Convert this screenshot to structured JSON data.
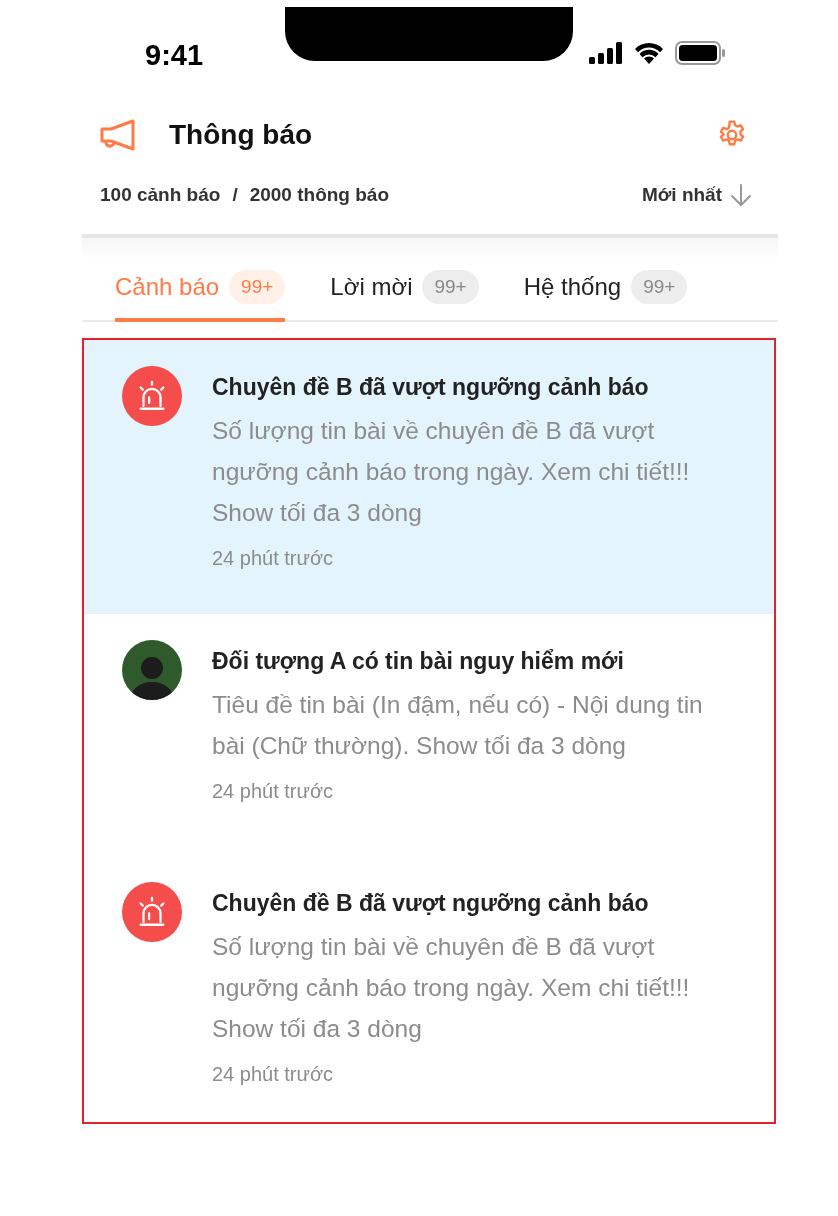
{
  "status_bar": {
    "time": "9:41"
  },
  "header": {
    "title": "Thông báo",
    "alert_count": "100 cảnh báo",
    "separator": "/",
    "notification_count": "2000 thông báo",
    "sort": "Mới nhất"
  },
  "tabs": [
    {
      "label": "Cảnh báo",
      "badge": "99+",
      "selected": true
    },
    {
      "label": "Lời mời",
      "badge": "99+",
      "selected": false
    },
    {
      "label": "Hệ thống",
      "badge": "99+",
      "selected": false
    }
  ],
  "notifications": [
    {
      "kind": "alarm",
      "unread": true,
      "title": "Chuyên đề B đã vượt ngưỡng cảnh báo",
      "body": "Số lượng tin bài về chuyên đề B đã vượt ngưỡng cảnh báo trong ngày. Xem chi tiết!!! Show tối đa 3 dòng",
      "time": "24 phút trước"
    },
    {
      "kind": "avatar",
      "unread": false,
      "title": "Đối tượng A có tin bài nguy hiểm mới",
      "body": "Tiêu đề tin bài (In đậm, nếu có) - Nội dung tin bài (Chữ thường). Show tối đa 3 dòng",
      "time": "24 phút trước"
    },
    {
      "kind": "alarm",
      "unread": false,
      "title": "Chuyên đề B đã vượt ngưỡng cảnh báo",
      "body": "Số lượng tin bài về chuyên đề B đã vượt ngưỡng cảnh báo trong ngày. Xem chi tiết!!! Show tối đa 3 dòng",
      "time": "24 phút trước"
    }
  ]
}
